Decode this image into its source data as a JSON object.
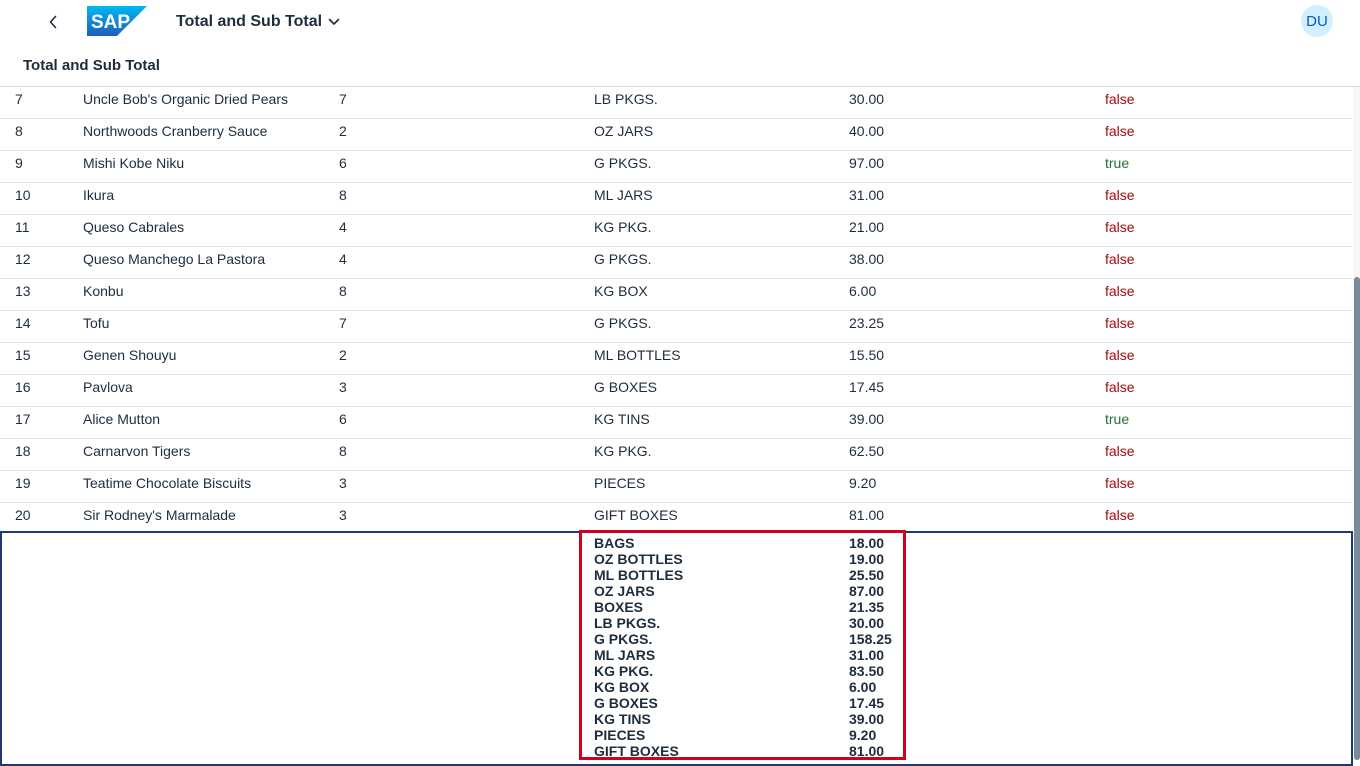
{
  "shell": {
    "app_title": "Total and Sub Total",
    "avatar_initials": "DU",
    "logo_text": "SAP"
  },
  "page": {
    "title": "Total and Sub Total"
  },
  "table": {
    "rows": [
      {
        "id": "7",
        "name": "Uncle Bob's Organic Dried Pears",
        "category": "7",
        "unit": "LB PKGS.",
        "price": "30.00",
        "discontinued": "false"
      },
      {
        "id": "8",
        "name": "Northwoods Cranberry Sauce",
        "category": "2",
        "unit": "OZ JARS",
        "price": "40.00",
        "discontinued": "false"
      },
      {
        "id": "9",
        "name": "Mishi Kobe Niku",
        "category": "6",
        "unit": "G PKGS.",
        "price": "97.00",
        "discontinued": "true"
      },
      {
        "id": "10",
        "name": "Ikura",
        "category": "8",
        "unit": "ML JARS",
        "price": "31.00",
        "discontinued": "false"
      },
      {
        "id": "11",
        "name": "Queso Cabrales",
        "category": "4",
        "unit": "KG PKG.",
        "price": "21.00",
        "discontinued": "false"
      },
      {
        "id": "12",
        "name": "Queso Manchego La Pastora",
        "category": "4",
        "unit": "G PKGS.",
        "price": "38.00",
        "discontinued": "false"
      },
      {
        "id": "13",
        "name": "Konbu",
        "category": "8",
        "unit": "KG BOX",
        "price": "6.00",
        "discontinued": "false"
      },
      {
        "id": "14",
        "name": "Tofu",
        "category": "7",
        "unit": "G PKGS.",
        "price": "23.25",
        "discontinued": "false"
      },
      {
        "id": "15",
        "name": "Genen Shouyu",
        "category": "2",
        "unit": "ML BOTTLES",
        "price": "15.50",
        "discontinued": "false"
      },
      {
        "id": "16",
        "name": "Pavlova",
        "category": "3",
        "unit": "G BOXES",
        "price": "17.45",
        "discontinued": "false"
      },
      {
        "id": "17",
        "name": "Alice Mutton",
        "category": "6",
        "unit": "KG TINS",
        "price": "39.00",
        "discontinued": "true"
      },
      {
        "id": "18",
        "name": "Carnarvon Tigers",
        "category": "8",
        "unit": "KG PKG.",
        "price": "62.50",
        "discontinued": "false"
      },
      {
        "id": "19",
        "name": "Teatime Chocolate Biscuits",
        "category": "3",
        "unit": "PIECES",
        "price": "9.20",
        "discontinued": "false"
      },
      {
        "id": "20",
        "name": "Sir Rodney's Marmalade",
        "category": "3",
        "unit": "GIFT BOXES",
        "price": "81.00",
        "discontinued": "false"
      }
    ]
  },
  "totals": [
    {
      "unit": "BAGS",
      "value": "18.00"
    },
    {
      "unit": "OZ BOTTLES",
      "value": "19.00"
    },
    {
      "unit": "ML BOTTLES",
      "value": "25.50"
    },
    {
      "unit": "OZ JARS",
      "value": "87.00"
    },
    {
      "unit": "BOXES",
      "value": "21.35"
    },
    {
      "unit": "LB PKGS.",
      "value": "30.00"
    },
    {
      "unit": "G PKGS.",
      "value": "158.25"
    },
    {
      "unit": "ML JARS",
      "value": "31.00"
    },
    {
      "unit": "KG PKG.",
      "value": "83.50"
    },
    {
      "unit": "KG BOX",
      "value": "6.00"
    },
    {
      "unit": "G BOXES",
      "value": "17.45"
    },
    {
      "unit": "KG TINS",
      "value": "39.00"
    },
    {
      "unit": "PIECES",
      "value": "9.20"
    },
    {
      "unit": "GIFT BOXES",
      "value": "81.00"
    }
  ],
  "icons": {
    "back": "chevron-left-icon",
    "title_menu": "chevron-down-icon"
  },
  "colors": {
    "false_value": "#aa0808",
    "true_value": "#256f3a",
    "highlight_border": "#d0001f",
    "panel_border": "#1c3a6e",
    "avatar_bg": "#d1efff"
  }
}
